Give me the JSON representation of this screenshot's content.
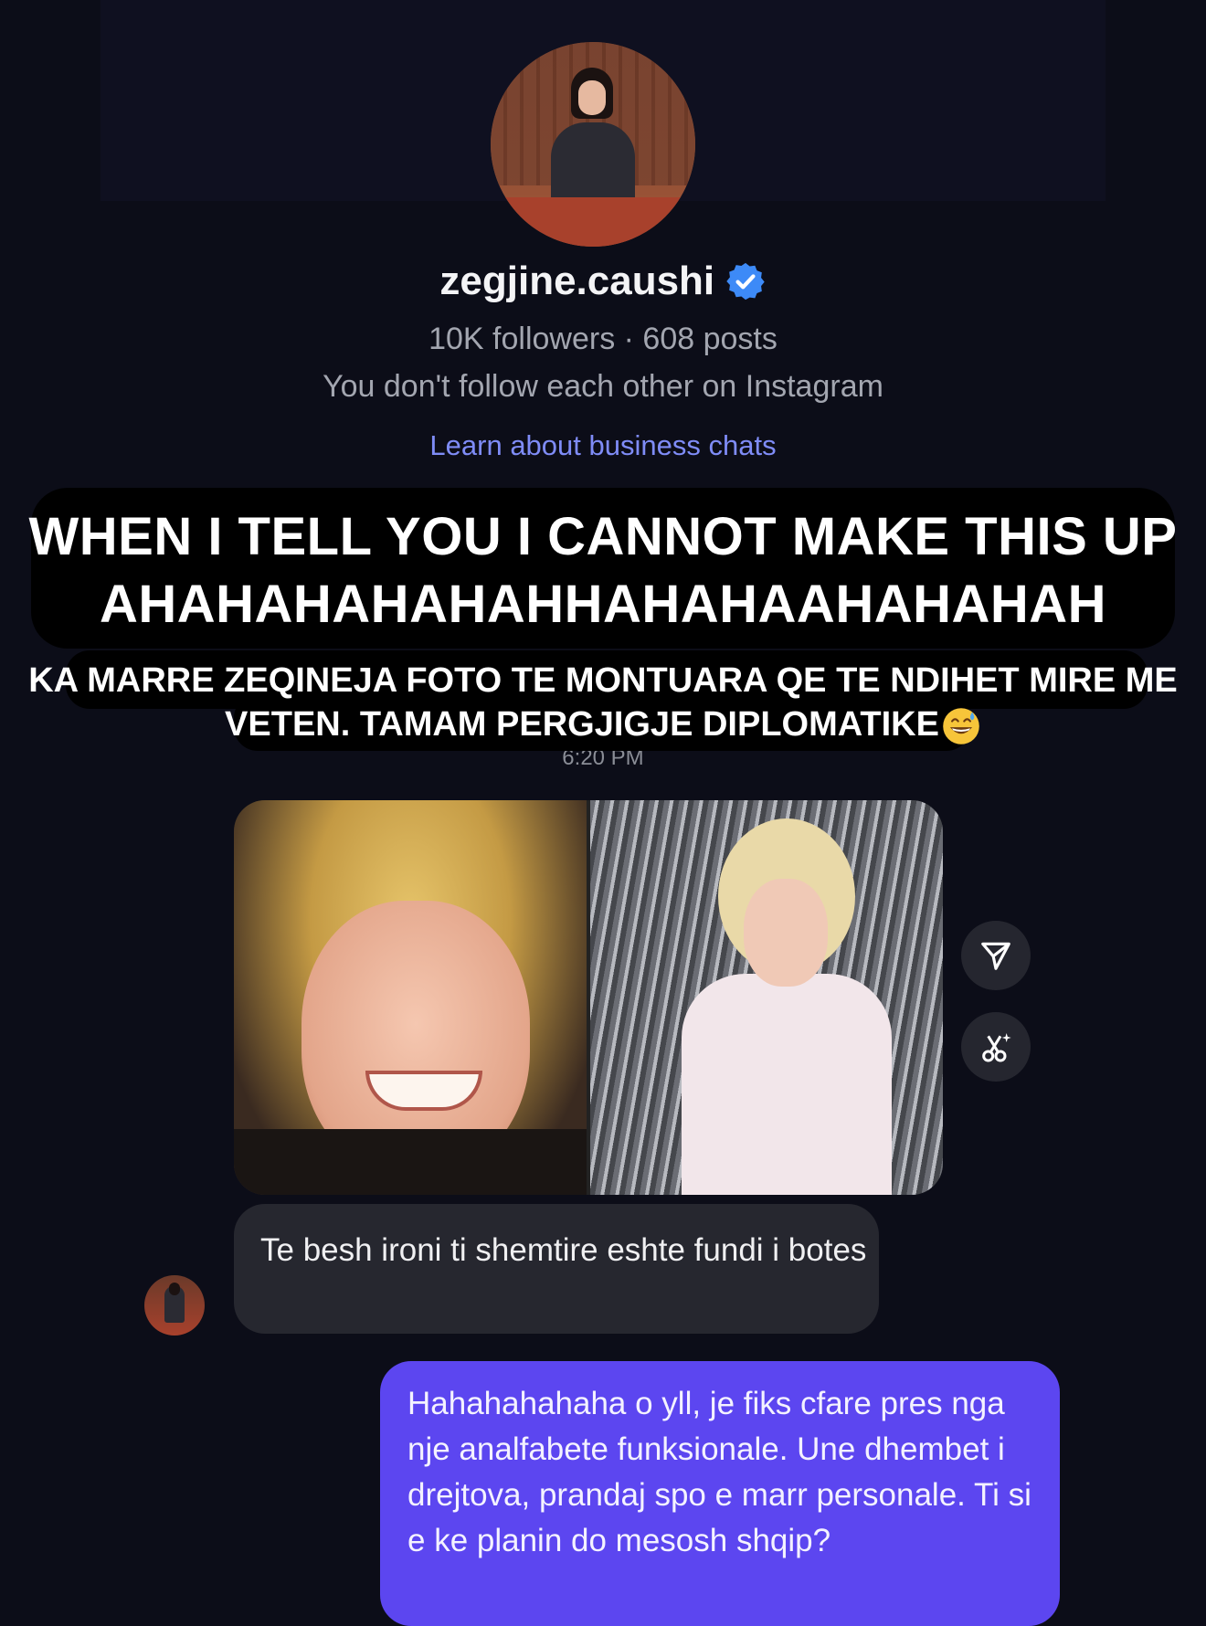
{
  "profile": {
    "username": "zegjine.caushi",
    "stats": "10K followers · 608 posts",
    "relation": "You don't follow each other on Instagram",
    "business_link": "Learn about business chats",
    "verified_color": "#3d8af7"
  },
  "overlay_caption": {
    "line1": "WHEN I TELL YOU I CANNOT MAKE THIS UP",
    "line2": "AHAHAHAHAHAHHAHAHAAHAHAHAH",
    "sub_line1": "KA MARRE ZEQINEJA FOTO TE MONTUARA QE TE NDIHET MIRE ME",
    "sub_line2": "VETEN. TAMAM PERGJIGJE DIPLOMATIKE",
    "emoji": "grinning-face-with-sweat-icon"
  },
  "chat": {
    "timestamp_partial": "6:20 PM",
    "incoming_message": "Te besh ironi ti shemtire eshte fundi i botes",
    "outgoing_message": "Hahahahahaha o yll, je fiks cfare pres nga nje analfabete funksionale. Une dhembet i drejtova, prandaj spo e marr personale. Ti si e ke planin do mesosh shqip?",
    "actions": [
      "share-icon",
      "ai-edit-icon"
    ],
    "colors": {
      "background": "#0c0d18",
      "incoming_bubble": "#26272f",
      "outgoing_bubble": "#5c46f0",
      "link": "#7f8cf7"
    }
  }
}
